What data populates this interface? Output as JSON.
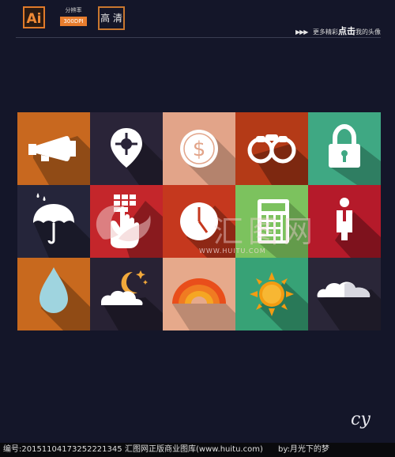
{
  "header": {
    "app_badge": "Ai",
    "resolution_label": "分辨率",
    "resolution_value": "300DPI",
    "quality_badge": "高 清",
    "more_link_prefix": "更多精彩",
    "more_link_emphasis": "点击",
    "more_link_suffix": "我的头像"
  },
  "icons": [
    {
      "name": "megaphone",
      "bg": "#c8681f"
    },
    {
      "name": "map-pin",
      "bg": "#2a2438"
    },
    {
      "name": "dollar-coin",
      "bg": "#e2a489"
    },
    {
      "name": "handcuffs",
      "bg": "#b43a17"
    },
    {
      "name": "padlock",
      "bg": "#3fa883"
    },
    {
      "name": "umbrella-rain",
      "bg": "#25253a"
    },
    {
      "name": "hand-keypad",
      "bg": "#c4262b"
    },
    {
      "name": "clock",
      "bg": "#c5381e"
    },
    {
      "name": "calculator",
      "bg": "#7cc25e"
    },
    {
      "name": "person",
      "bg": "#b51a2a"
    },
    {
      "name": "water-drop",
      "bg": "#c8691e"
    },
    {
      "name": "moon-cloud",
      "bg": "#282234"
    },
    {
      "name": "rainbow",
      "bg": "#e6a98b"
    },
    {
      "name": "sun",
      "bg": "#37a276"
    },
    {
      "name": "cloud",
      "bg": "#2a2638"
    }
  ],
  "watermark": {
    "text": "汇图网",
    "url": "WWW.HUITU.COM"
  },
  "signature": "cy",
  "footer": {
    "id_text": "编号:20151104173252221345",
    "site_text": "汇图网正版商业图库(www.huitu.com)",
    "author_text": "by:月光下的梦"
  }
}
